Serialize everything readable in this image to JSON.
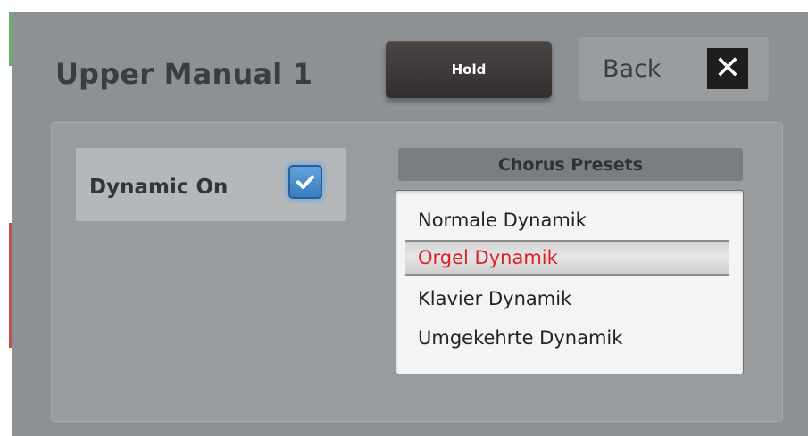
{
  "dialog": {
    "title": "Upper Manual 1",
    "hold_label": "Hold",
    "back_label": "Back",
    "close_glyph": "✕",
    "close_icon": "close-icon"
  },
  "dynamic": {
    "label": "Dynamic On",
    "checked": true,
    "check_icon": "checkmark-icon"
  },
  "presets": {
    "header": "Chorus Presets",
    "items": [
      {
        "label": "Normale Dynamik",
        "selected": false
      },
      {
        "label": "Orgel Dynamik",
        "selected": true
      },
      {
        "label": "Klavier Dynamik",
        "selected": false
      },
      {
        "label": "Umgekehrte Dynamik",
        "selected": false
      }
    ],
    "selected_color": "#e02020"
  },
  "colors": {
    "window_bg": "#8e9194",
    "panel_bg": "#999c9f",
    "hold_button": "#3c3837",
    "checkbox_accent": "#4a90d9"
  }
}
